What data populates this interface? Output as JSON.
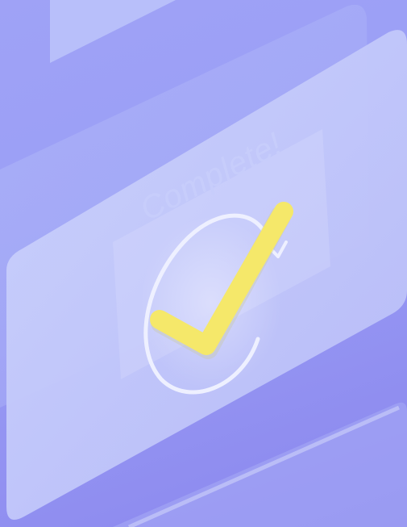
{
  "illustration": {
    "status_text": "Complete!",
    "icon": "checkmark-icon",
    "colors": {
      "background": "#9b9ff6",
      "panel": "#c9cffb",
      "checkmark": "#f5e86a",
      "ring": "#eef0ff"
    }
  }
}
